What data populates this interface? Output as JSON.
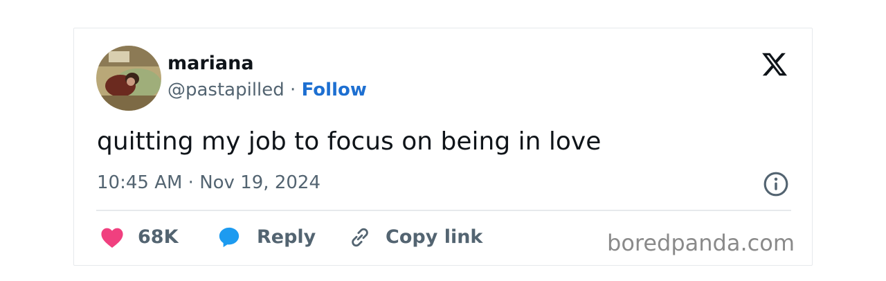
{
  "tweet": {
    "author_name": "mariana",
    "handle": "@pastapilled",
    "separator": " · ",
    "follow_label": "Follow",
    "text": "quitting my job to focus on being in love",
    "timestamp": "10:45 AM · Nov 19, 2024",
    "likes_count": "68K",
    "reply_label": "Reply",
    "copy_link_label": "Copy link"
  },
  "watermark": "boredpanda.com",
  "icons": {
    "platform": "x-logo-icon",
    "info": "info-icon",
    "like": "heart-icon",
    "reply": "speech-bubble-icon",
    "copy": "link-icon"
  },
  "colors": {
    "follow": "#1d6fd1",
    "heart": "#f0407f",
    "reply_bubble": "#1d9bf0",
    "text": "#0f1419",
    "secondary": "#536471"
  }
}
